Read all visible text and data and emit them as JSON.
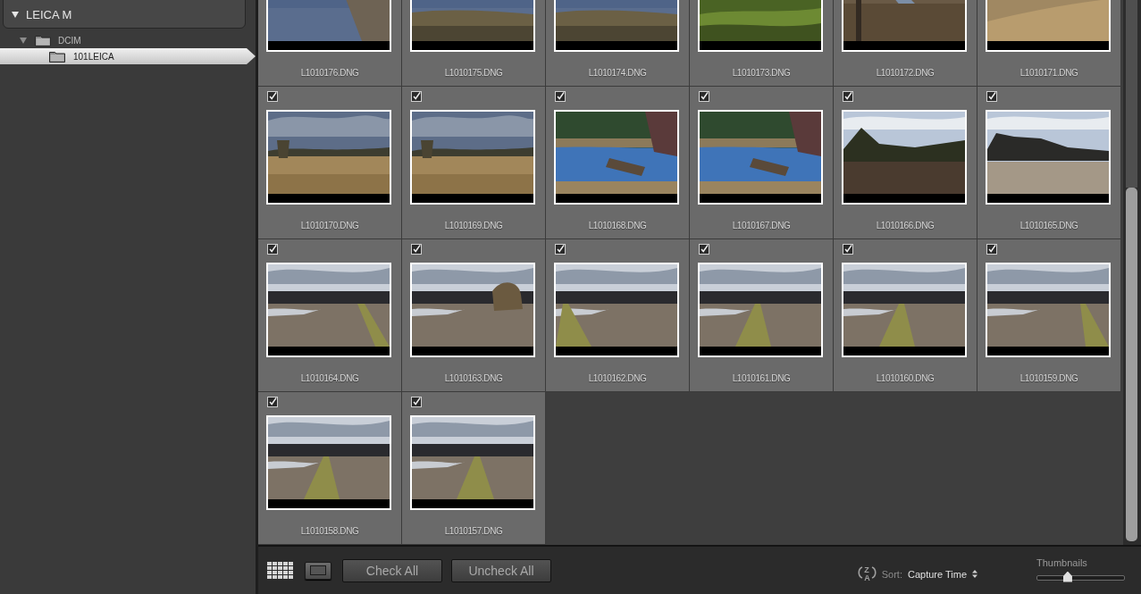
{
  "sidebar": {
    "source": {
      "label": "LEICA M",
      "expanded": true,
      "children": [
        {
          "label": "DCIM",
          "expanded": true,
          "selected": false,
          "children": [
            {
              "label": "101LEICA",
              "selected": true
            }
          ]
        }
      ]
    }
  },
  "photos": [
    {
      "filename": "L1010176.DNG"
    },
    {
      "filename": "L1010175.DNG"
    },
    {
      "filename": "L1010174.DNG"
    },
    {
      "filename": "L1010173.DNG"
    },
    {
      "filename": "L1010172.DNG"
    },
    {
      "filename": "L1010171.DNG"
    },
    {
      "filename": "L1010170.DNG",
      "checked": true
    },
    {
      "filename": "L1010169.DNG",
      "checked": true
    },
    {
      "filename": "L1010168.DNG",
      "checked": true
    },
    {
      "filename": "L1010167.DNG",
      "checked": true
    },
    {
      "filename": "L1010166.DNG",
      "checked": true
    },
    {
      "filename": "L1010165.DNG",
      "checked": true
    },
    {
      "filename": "L1010164.DNG",
      "checked": true
    },
    {
      "filename": "L1010163.DNG",
      "checked": true
    },
    {
      "filename": "L1010162.DNG",
      "checked": true
    },
    {
      "filename": "L1010161.DNG",
      "checked": true
    },
    {
      "filename": "L1010160.DNG",
      "checked": true
    },
    {
      "filename": "L1010159.DNG",
      "checked": true
    },
    {
      "filename": "L1010158.DNG",
      "checked": true
    },
    {
      "filename": "L1010157.DNG",
      "checked": true
    }
  ],
  "toolbar": {
    "view_buttons": [
      {
        "kind": "grid",
        "selected": true
      },
      {
        "kind": "loupe",
        "selected": false
      }
    ],
    "buttons": [
      "Check All",
      "Uncheck All"
    ],
    "sort": {
      "order_icon": [
        "Z",
        "A"
      ],
      "label": "Sort:",
      "value": "Capture Time"
    },
    "thumbnails": {
      "label": "Thumbnails",
      "level": 0.35
    }
  }
}
